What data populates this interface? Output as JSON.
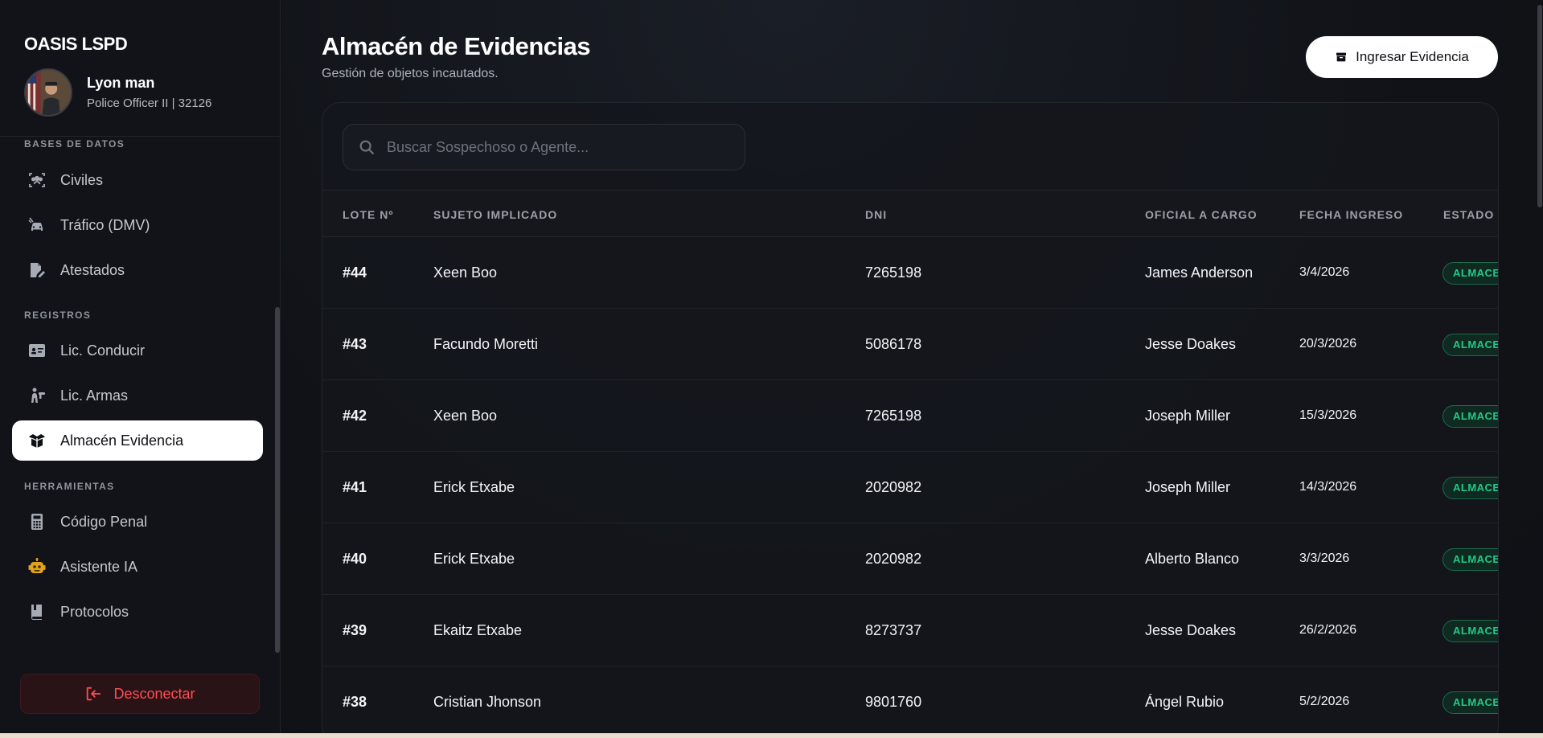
{
  "app": {
    "brand": "OASIS LSPD"
  },
  "user": {
    "name": "Lyon man",
    "rank": "Police Officer II | 32126"
  },
  "sidebar": {
    "sections": [
      {
        "label": "BASES DE DATOS"
      },
      {
        "label": "REGISTROS"
      },
      {
        "label": "HERRAMIENTAS"
      }
    ],
    "items": [
      {
        "label": "Civiles",
        "icon": "users-icon"
      },
      {
        "label": "Tráfico (DMV)",
        "icon": "car-icon"
      },
      {
        "label": "Atestados",
        "icon": "document-edit-icon"
      },
      {
        "label": "Lic. Conducir",
        "icon": "id-card-icon"
      },
      {
        "label": "Lic. Armas",
        "icon": "gun-license-icon"
      },
      {
        "label": "Almacén Evidencia",
        "icon": "box-open-icon",
        "active": true
      },
      {
        "label": "Código Penal",
        "icon": "calculator-icon"
      },
      {
        "label": "Asistente IA",
        "icon": "robot-icon"
      },
      {
        "label": "Protocolos",
        "icon": "book-icon"
      }
    ],
    "logout_label": "Desconectar"
  },
  "header": {
    "title": "Almacén de Evidencias",
    "subtitle": "Gestión de objetos incautados.",
    "add_button": "Ingresar Evidencia"
  },
  "search": {
    "placeholder": "Buscar Sospechoso o Agente..."
  },
  "table": {
    "columns": [
      "LOTE Nº",
      "SUJETO IMPLICADO",
      "DNI",
      "OFICIAL A CARGO",
      "FECHA INGRESO",
      "ESTADO"
    ],
    "rows": [
      {
        "lote": "#44",
        "sujeto": "Xeen Boo",
        "dni": "7265198",
        "oficial": "James Anderson",
        "fecha": "3/4/2026",
        "estado": "ALMACE"
      },
      {
        "lote": "#43",
        "sujeto": "Facundo Moretti",
        "dni": "5086178",
        "oficial": "Jesse Doakes",
        "fecha": "20/3/2026",
        "estado": "ALMACE"
      },
      {
        "lote": "#42",
        "sujeto": "Xeen Boo",
        "dni": "7265198",
        "oficial": "Joseph Miller",
        "fecha": "15/3/2026",
        "estado": "ALMACE"
      },
      {
        "lote": "#41",
        "sujeto": "Erick Etxabe",
        "dni": "2020982",
        "oficial": "Joseph Miller",
        "fecha": "14/3/2026",
        "estado": "ALMACE"
      },
      {
        "lote": "#40",
        "sujeto": "Erick Etxabe",
        "dni": "2020982",
        "oficial": "Alberto Blanco",
        "fecha": "3/3/2026",
        "estado": "ALMACE"
      },
      {
        "lote": "#39",
        "sujeto": "Ekaitz Etxabe",
        "dni": "8273737",
        "oficial": "Jesse Doakes",
        "fecha": "26/2/2026",
        "estado": "ALMACE"
      },
      {
        "lote": "#38",
        "sujeto": "Cristian Jhonson",
        "dni": "9801760",
        "oficial": "Ángel Rubio",
        "fecha": "5/2/2026",
        "estado": "ALMACE"
      }
    ]
  },
  "colors": {
    "accent": "#ffffff",
    "danger": "#ff4d52",
    "success": "#22c98a",
    "background": "#0e1014"
  }
}
